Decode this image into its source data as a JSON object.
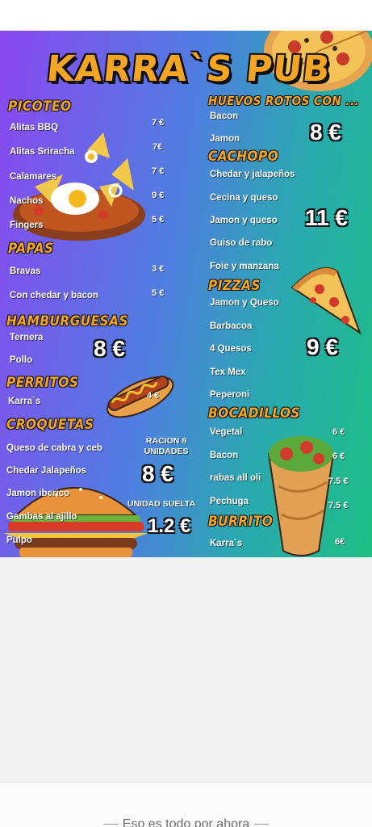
{
  "menu": {
    "title": "KARRA`S PUB",
    "left": {
      "picoteo": {
        "heading": "PICOTEO",
        "items": [
          {
            "name": "Alitas BBQ",
            "price": "7 €"
          },
          {
            "name": "Alitas Sriracha",
            "price": "7€"
          },
          {
            "name": "Calamares",
            "price": "7 €"
          },
          {
            "name": "Nachos",
            "price": "9 €"
          },
          {
            "name": "Fingers",
            "price": "5 €"
          }
        ]
      },
      "papas": {
        "heading": "PAPAS",
        "items": [
          {
            "name": "Bravas",
            "price": "3 €"
          },
          {
            "name": "Con chedar y bacon",
            "price": "5 €"
          }
        ]
      },
      "hamburguesas": {
        "heading": "HAMBURGUESAS",
        "items": [
          {
            "name": "Ternera"
          },
          {
            "name": "Pollo"
          }
        ],
        "price": "8 €"
      },
      "perritos": {
        "heading": "PERRITOS",
        "items": [
          {
            "name": "Karra`s",
            "price": "4 €"
          }
        ]
      },
      "croquetas": {
        "heading": "CROQUETAS",
        "items": [
          {
            "name": "Queso de cabra y ceb"
          },
          {
            "name": "Chedar Jalapeños"
          },
          {
            "name": "Jamon iberico"
          },
          {
            "name": "Gambas al ajillo"
          },
          {
            "name": "Pulpo"
          }
        ],
        "racion_label_1": "RACION 8",
        "racion_label_2": "UNIDADES",
        "racion_price": "8 €",
        "suelta_label": "UNIDAD SUELTA",
        "suelta_price": "1.2 €"
      }
    },
    "right": {
      "huevos": {
        "heading": "HUEVOS ROTOS CON ...",
        "items": [
          {
            "name": "Bacon"
          },
          {
            "name": "Jamon"
          }
        ],
        "price": "8 €"
      },
      "cachopo": {
        "heading": "CACHOPO",
        "items": [
          {
            "name": "Chedar y jalapeños"
          },
          {
            "name": "Cecina y queso"
          },
          {
            "name": "Jamon y queso"
          },
          {
            "name": "Guiso de rabo"
          },
          {
            "name": "Foie y manzana"
          }
        ],
        "price": "11 €"
      },
      "pizzas": {
        "heading": "PIZZAS",
        "items": [
          {
            "name": "Jamon y Queso"
          },
          {
            "name": "Barbacoa"
          },
          {
            "name": "4 Quesos"
          },
          {
            "name": "Tex Mex"
          },
          {
            "name": "Peperoni"
          }
        ],
        "price": "9 €"
      },
      "bocadillos": {
        "heading": "BOCADILLOS",
        "items": [
          {
            "name": "Vegetal",
            "price": "6 €"
          },
          {
            "name": "Bacon",
            "price": "6 €"
          },
          {
            "name": "rabas all oli",
            "price": "7.5 €"
          },
          {
            "name": "Pechuga",
            "price": "7.5 €"
          }
        ]
      },
      "burrito": {
        "heading": "BURRITO",
        "items": [
          {
            "name": "Karra`s",
            "price": "6€"
          }
        ]
      }
    }
  },
  "footer": {
    "text": "Eso es todo por ahora"
  },
  "colors": {
    "accent": "#f5a524",
    "gradient_start": "#8a47f0",
    "gradient_end": "#1dbf85"
  }
}
